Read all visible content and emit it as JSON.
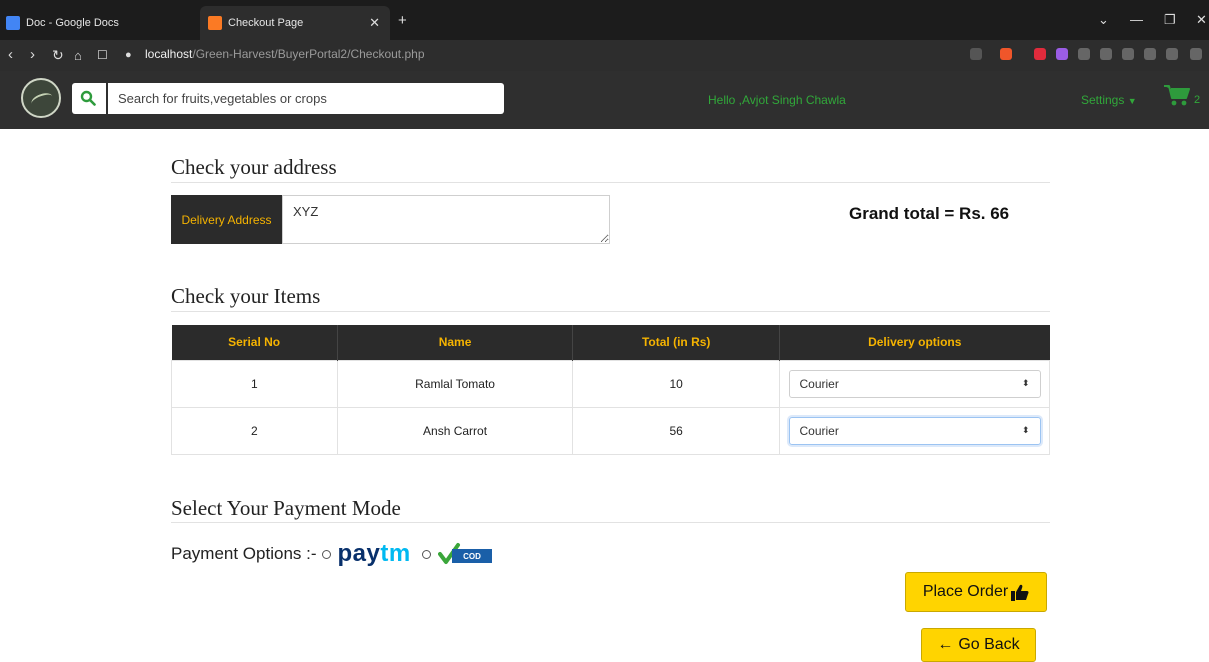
{
  "browser": {
    "tabs": [
      {
        "label": "Doc - Google Docs"
      },
      {
        "label": "Checkout Page"
      }
    ],
    "new_tab": "+",
    "url_host": "localhost",
    "url_path": "/Green-Harvest/BuyerPortal2/Checkout.php"
  },
  "navbar": {
    "search_placeholder": "Search for fruits,vegetables or crops",
    "greeting": "Hello ,Avjot Singh Chawla",
    "settings_label": "Settings",
    "cart_count": "2",
    "colors": {
      "accent": "#31a83a",
      "bar": "#2f2f2f"
    }
  },
  "address": {
    "heading": "Check your address",
    "label": "Delivery Address",
    "value": "XYZ",
    "grand_total": "Grand total = Rs. 66"
  },
  "items": {
    "heading": "Check your Items",
    "columns": [
      "Serial No",
      "Name",
      "Total (in Rs)",
      "Delivery options"
    ],
    "rows": [
      {
        "serial": "1",
        "name": "Ramlal Tomato",
        "total": "10",
        "delivery": "Courier"
      },
      {
        "serial": "2",
        "name": "Ansh Carrot",
        "total": "56",
        "delivery": "Courier"
      }
    ]
  },
  "payment": {
    "heading": "Select Your Payment Mode",
    "label": "Payment Options :-",
    "paytm_pay": "pay",
    "paytm_tm": "tm",
    "cod_text": "COD"
  },
  "actions": {
    "place_order": "Place Order",
    "go_back": "Go Back"
  },
  "colors": {
    "header_bg": "#2b2b2b",
    "header_text": "#f5b301",
    "button": "#ffd400"
  }
}
